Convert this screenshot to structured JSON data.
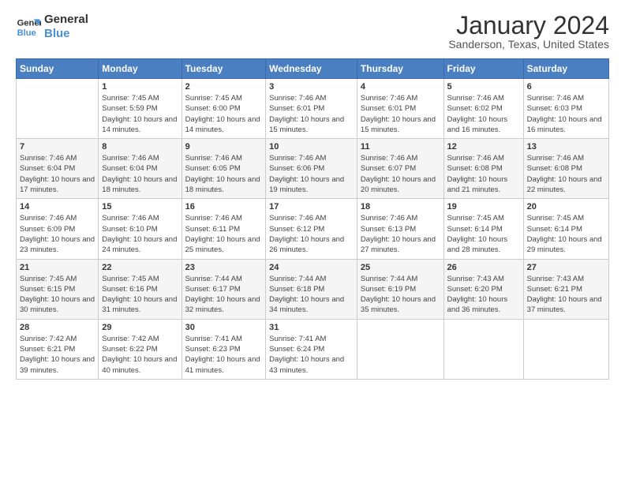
{
  "logo": {
    "line1": "General",
    "line2": "Blue"
  },
  "title": "January 2024",
  "subtitle": "Sanderson, Texas, United States",
  "weekdays": [
    "Sunday",
    "Monday",
    "Tuesday",
    "Wednesday",
    "Thursday",
    "Friday",
    "Saturday"
  ],
  "weeks": [
    [
      {
        "day": "",
        "sunrise": "",
        "sunset": "",
        "daylight": ""
      },
      {
        "day": "1",
        "sunrise": "Sunrise: 7:45 AM",
        "sunset": "Sunset: 5:59 PM",
        "daylight": "Daylight: 10 hours and 14 minutes."
      },
      {
        "day": "2",
        "sunrise": "Sunrise: 7:45 AM",
        "sunset": "Sunset: 6:00 PM",
        "daylight": "Daylight: 10 hours and 14 minutes."
      },
      {
        "day": "3",
        "sunrise": "Sunrise: 7:46 AM",
        "sunset": "Sunset: 6:01 PM",
        "daylight": "Daylight: 10 hours and 15 minutes."
      },
      {
        "day": "4",
        "sunrise": "Sunrise: 7:46 AM",
        "sunset": "Sunset: 6:01 PM",
        "daylight": "Daylight: 10 hours and 15 minutes."
      },
      {
        "day": "5",
        "sunrise": "Sunrise: 7:46 AM",
        "sunset": "Sunset: 6:02 PM",
        "daylight": "Daylight: 10 hours and 16 minutes."
      },
      {
        "day": "6",
        "sunrise": "Sunrise: 7:46 AM",
        "sunset": "Sunset: 6:03 PM",
        "daylight": "Daylight: 10 hours and 16 minutes."
      }
    ],
    [
      {
        "day": "7",
        "sunrise": "Sunrise: 7:46 AM",
        "sunset": "Sunset: 6:04 PM",
        "daylight": "Daylight: 10 hours and 17 minutes."
      },
      {
        "day": "8",
        "sunrise": "Sunrise: 7:46 AM",
        "sunset": "Sunset: 6:04 PM",
        "daylight": "Daylight: 10 hours and 18 minutes."
      },
      {
        "day": "9",
        "sunrise": "Sunrise: 7:46 AM",
        "sunset": "Sunset: 6:05 PM",
        "daylight": "Daylight: 10 hours and 18 minutes."
      },
      {
        "day": "10",
        "sunrise": "Sunrise: 7:46 AM",
        "sunset": "Sunset: 6:06 PM",
        "daylight": "Daylight: 10 hours and 19 minutes."
      },
      {
        "day": "11",
        "sunrise": "Sunrise: 7:46 AM",
        "sunset": "Sunset: 6:07 PM",
        "daylight": "Daylight: 10 hours and 20 minutes."
      },
      {
        "day": "12",
        "sunrise": "Sunrise: 7:46 AM",
        "sunset": "Sunset: 6:08 PM",
        "daylight": "Daylight: 10 hours and 21 minutes."
      },
      {
        "day": "13",
        "sunrise": "Sunrise: 7:46 AM",
        "sunset": "Sunset: 6:08 PM",
        "daylight": "Daylight: 10 hours and 22 minutes."
      }
    ],
    [
      {
        "day": "14",
        "sunrise": "Sunrise: 7:46 AM",
        "sunset": "Sunset: 6:09 PM",
        "daylight": "Daylight: 10 hours and 23 minutes."
      },
      {
        "day": "15",
        "sunrise": "Sunrise: 7:46 AM",
        "sunset": "Sunset: 6:10 PM",
        "daylight": "Daylight: 10 hours and 24 minutes."
      },
      {
        "day": "16",
        "sunrise": "Sunrise: 7:46 AM",
        "sunset": "Sunset: 6:11 PM",
        "daylight": "Daylight: 10 hours and 25 minutes."
      },
      {
        "day": "17",
        "sunrise": "Sunrise: 7:46 AM",
        "sunset": "Sunset: 6:12 PM",
        "daylight": "Daylight: 10 hours and 26 minutes."
      },
      {
        "day": "18",
        "sunrise": "Sunrise: 7:46 AM",
        "sunset": "Sunset: 6:13 PM",
        "daylight": "Daylight: 10 hours and 27 minutes."
      },
      {
        "day": "19",
        "sunrise": "Sunrise: 7:45 AM",
        "sunset": "Sunset: 6:14 PM",
        "daylight": "Daylight: 10 hours and 28 minutes."
      },
      {
        "day": "20",
        "sunrise": "Sunrise: 7:45 AM",
        "sunset": "Sunset: 6:14 PM",
        "daylight": "Daylight: 10 hours and 29 minutes."
      }
    ],
    [
      {
        "day": "21",
        "sunrise": "Sunrise: 7:45 AM",
        "sunset": "Sunset: 6:15 PM",
        "daylight": "Daylight: 10 hours and 30 minutes."
      },
      {
        "day": "22",
        "sunrise": "Sunrise: 7:45 AM",
        "sunset": "Sunset: 6:16 PM",
        "daylight": "Daylight: 10 hours and 31 minutes."
      },
      {
        "day": "23",
        "sunrise": "Sunrise: 7:44 AM",
        "sunset": "Sunset: 6:17 PM",
        "daylight": "Daylight: 10 hours and 32 minutes."
      },
      {
        "day": "24",
        "sunrise": "Sunrise: 7:44 AM",
        "sunset": "Sunset: 6:18 PM",
        "daylight": "Daylight: 10 hours and 34 minutes."
      },
      {
        "day": "25",
        "sunrise": "Sunrise: 7:44 AM",
        "sunset": "Sunset: 6:19 PM",
        "daylight": "Daylight: 10 hours and 35 minutes."
      },
      {
        "day": "26",
        "sunrise": "Sunrise: 7:43 AM",
        "sunset": "Sunset: 6:20 PM",
        "daylight": "Daylight: 10 hours and 36 minutes."
      },
      {
        "day": "27",
        "sunrise": "Sunrise: 7:43 AM",
        "sunset": "Sunset: 6:21 PM",
        "daylight": "Daylight: 10 hours and 37 minutes."
      }
    ],
    [
      {
        "day": "28",
        "sunrise": "Sunrise: 7:42 AM",
        "sunset": "Sunset: 6:21 PM",
        "daylight": "Daylight: 10 hours and 39 minutes."
      },
      {
        "day": "29",
        "sunrise": "Sunrise: 7:42 AM",
        "sunset": "Sunset: 6:22 PM",
        "daylight": "Daylight: 10 hours and 40 minutes."
      },
      {
        "day": "30",
        "sunrise": "Sunrise: 7:41 AM",
        "sunset": "Sunset: 6:23 PM",
        "daylight": "Daylight: 10 hours and 41 minutes."
      },
      {
        "day": "31",
        "sunrise": "Sunrise: 7:41 AM",
        "sunset": "Sunset: 6:24 PM",
        "daylight": "Daylight: 10 hours and 43 minutes."
      },
      {
        "day": "",
        "sunrise": "",
        "sunset": "",
        "daylight": ""
      },
      {
        "day": "",
        "sunrise": "",
        "sunset": "",
        "daylight": ""
      },
      {
        "day": "",
        "sunrise": "",
        "sunset": "",
        "daylight": ""
      }
    ]
  ]
}
